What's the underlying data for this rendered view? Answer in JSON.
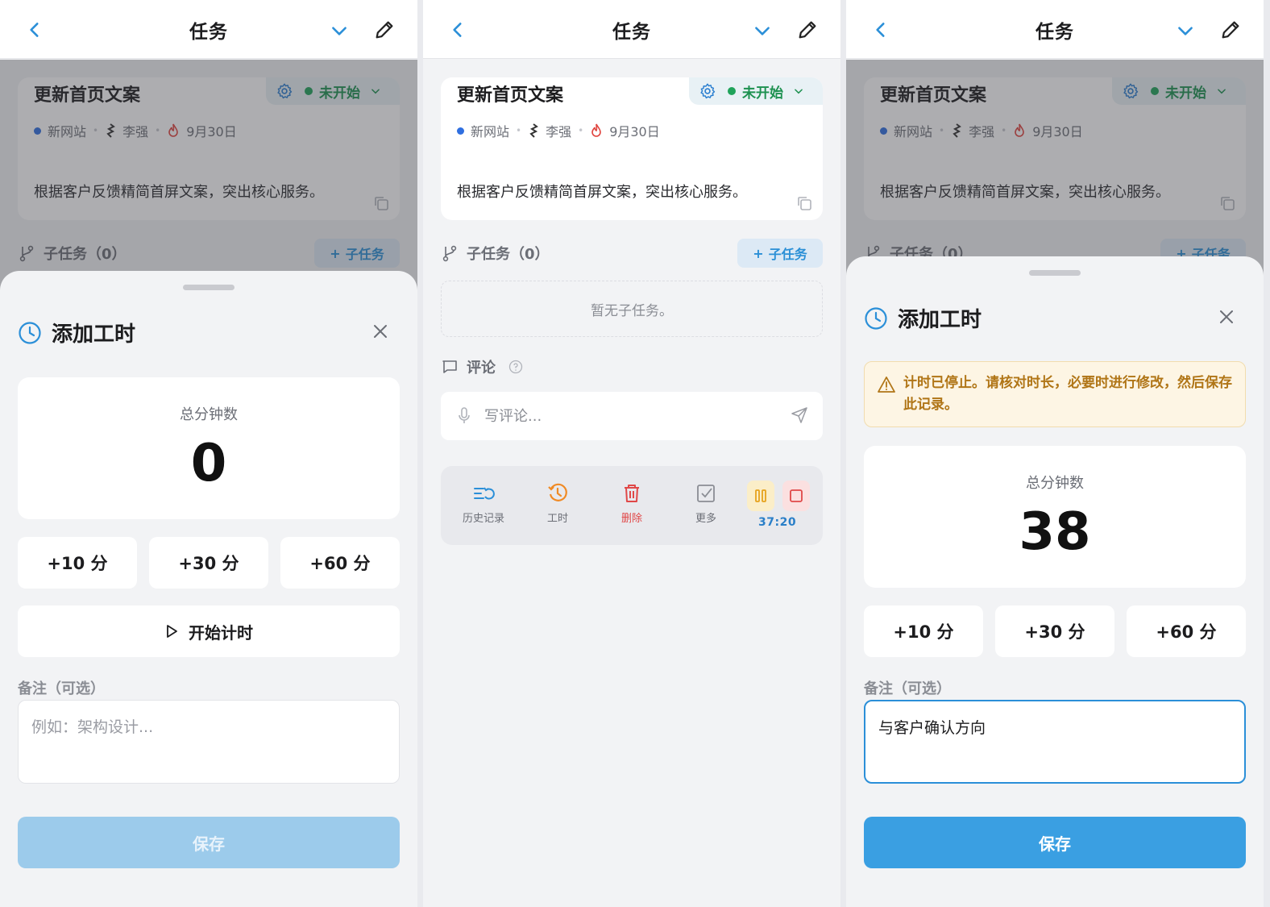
{
  "nav": {
    "title": "任务"
  },
  "task": {
    "title": "更新首页文案",
    "status": "未开始",
    "project": "新网站",
    "assignee": "李强",
    "due": "9月30日",
    "description": "根据客户反馈精简首屏文案，突出核心服务。"
  },
  "subtasks": {
    "label": "子任务（0）",
    "add_label": "子任务",
    "empty": "暂无子任务。"
  },
  "comments": {
    "label": "评论",
    "placeholder": "写评论..."
  },
  "toolbar": {
    "history": "历史记录",
    "worktime": "工时",
    "delete": "删除",
    "more": "更多",
    "timer": "37:20"
  },
  "sheet_empty": {
    "title": "添加工时",
    "total_label": "总分钟数",
    "total_value": "0",
    "quick": [
      "+10 分",
      "+30 分",
      "+60 分"
    ],
    "start_label": "开始计时",
    "note_label": "备注（可选）",
    "note_placeholder": "例如：架构设计...",
    "save_label": "保存"
  },
  "sheet_filled": {
    "title": "添加工时",
    "warning": "计时已停止。请核对时长，必要时进行修改，然后保存此记录。",
    "total_label": "总分钟数",
    "total_value": "38",
    "quick": [
      "+10 分",
      "+30 分",
      "+60 分"
    ],
    "note_label": "备注（可选）",
    "note_value": "与客户确认方向",
    "save_label": "保存"
  },
  "colors": {
    "accent": "#3a9fe2",
    "status_green": "#1d9150",
    "delete_red": "#e04848",
    "worktime_orange": "#f08a24",
    "warning_bg": "#fdf5e4"
  },
  "icons": [
    "back-icon",
    "chevron-down-icon",
    "pencil-icon",
    "gear-icon",
    "fire-icon",
    "copy-icon",
    "branch-icon",
    "plus-icon",
    "comment-icon",
    "help-icon",
    "mic-icon",
    "send-icon",
    "history-icon",
    "clock-icon",
    "trash-icon",
    "checkbox-icon",
    "pause-icon",
    "stop-icon",
    "close-icon",
    "play-icon",
    "warning-icon"
  ]
}
